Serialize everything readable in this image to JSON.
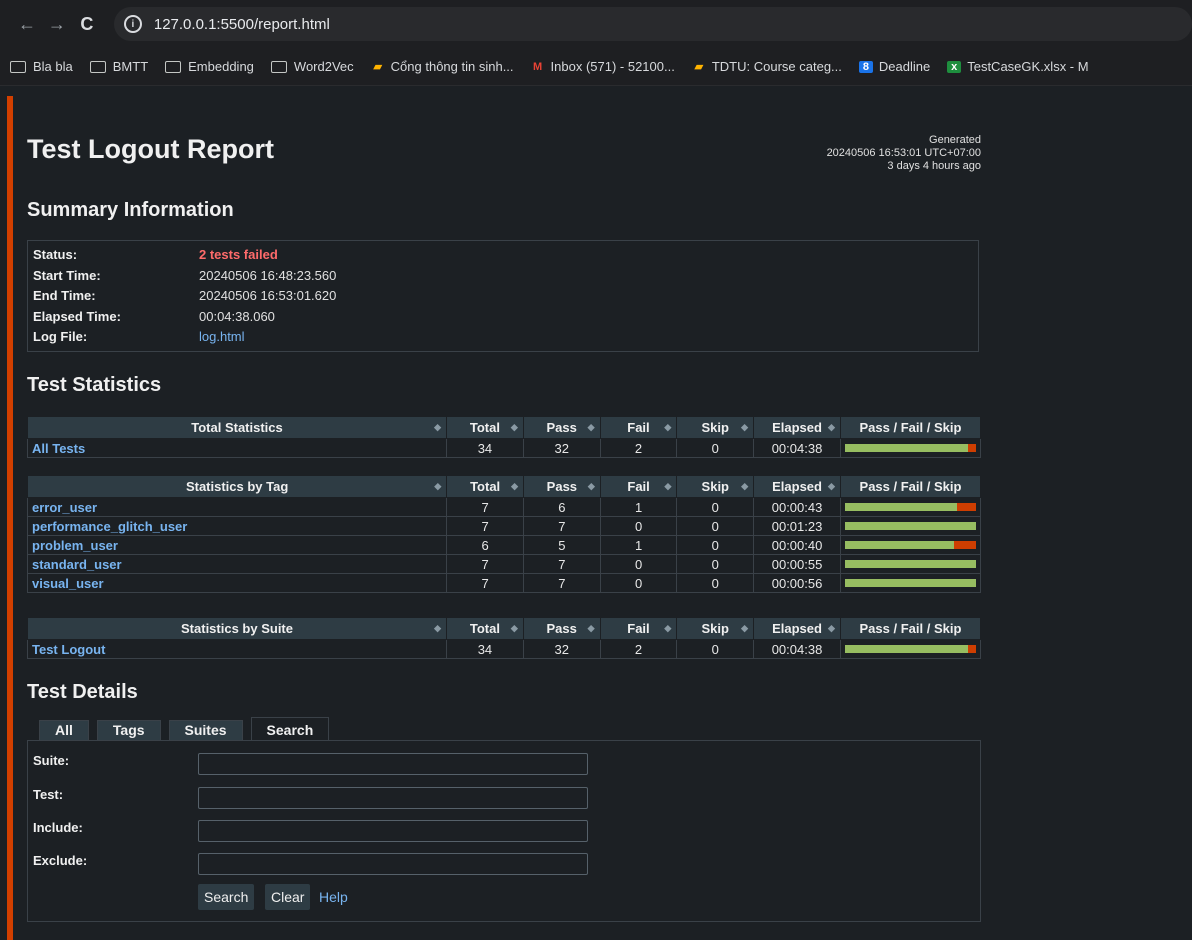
{
  "browser": {
    "url": "127.0.0.1:5500/report.html",
    "bookmarks": [
      {
        "label": "Bla bla",
        "type": "folder"
      },
      {
        "label": "BMTT",
        "type": "folder"
      },
      {
        "label": "Embedding",
        "type": "folder"
      },
      {
        "label": "Word2Vec",
        "type": "folder"
      },
      {
        "label": "Cổng thông tin sinh...",
        "type": "site"
      },
      {
        "label": "Inbox (571) - 52100...",
        "type": "gmail"
      },
      {
        "label": "TDTU: Course categ...",
        "type": "site"
      },
      {
        "label": "Deadline",
        "type": "calendar"
      },
      {
        "label": "TestCaseGK.xlsx - M",
        "type": "sheet"
      }
    ]
  },
  "report": {
    "title": "Test Logout Report",
    "generated_label": "Generated",
    "generated_time": "20240506 16:53:01 UTC+07:00",
    "generated_ago": "3 days 4 hours ago",
    "summary_heading": "Summary Information",
    "summary": [
      {
        "label": "Status:",
        "value": "2 tests failed",
        "kind": "fail"
      },
      {
        "label": "Start Time:",
        "value": "20240506 16:48:23.560",
        "kind": "text"
      },
      {
        "label": "End Time:",
        "value": "20240506 16:53:01.620",
        "kind": "text"
      },
      {
        "label": "Elapsed Time:",
        "value": "00:04:38.060",
        "kind": "text"
      },
      {
        "label": "Log File:",
        "value": "log.html",
        "kind": "link"
      }
    ],
    "stats_heading": "Test Statistics",
    "columns": [
      "Total",
      "Pass",
      "Fail",
      "Skip",
      "Elapsed",
      "Pass / Fail / Skip"
    ],
    "total_stats": {
      "header": "Total Statistics",
      "rows": [
        {
          "name": "All Tests",
          "total": "34",
          "pass": "32",
          "fail": "2",
          "skip": "0",
          "elapsed": "00:04:38"
        }
      ]
    },
    "tag_stats": {
      "header": "Statistics by Tag",
      "rows": [
        {
          "name": "error_user",
          "total": "7",
          "pass": "6",
          "fail": "1",
          "skip": "0",
          "elapsed": "00:00:43"
        },
        {
          "name": "performance_glitch_user",
          "total": "7",
          "pass": "7",
          "fail": "0",
          "skip": "0",
          "elapsed": "00:01:23"
        },
        {
          "name": "problem_user",
          "total": "6",
          "pass": "5",
          "fail": "1",
          "skip": "0",
          "elapsed": "00:00:40"
        },
        {
          "name": "standard_user",
          "total": "7",
          "pass": "7",
          "fail": "0",
          "skip": "0",
          "elapsed": "00:00:55"
        },
        {
          "name": "visual_user",
          "total": "7",
          "pass": "7",
          "fail": "0",
          "skip": "0",
          "elapsed": "00:00:56"
        }
      ]
    },
    "suite_stats": {
      "header": "Statistics by Suite",
      "rows": [
        {
          "name": "Test Logout",
          "total": "34",
          "pass": "32",
          "fail": "2",
          "skip": "0",
          "elapsed": "00:04:38"
        }
      ]
    },
    "details_heading": "Test Details",
    "tabs": [
      "All",
      "Tags",
      "Suites",
      "Search"
    ],
    "active_tab": "Search",
    "search_fields": [
      "Suite:",
      "Test:",
      "Include:",
      "Exclude:"
    ],
    "buttons": {
      "search": "Search",
      "clear": "Clear",
      "help": "Help"
    }
  },
  "colors": {
    "pass": "#97bd61",
    "fail": "#ce3e01",
    "skip": "#fed84f",
    "accent_bar": "#d23f00"
  }
}
